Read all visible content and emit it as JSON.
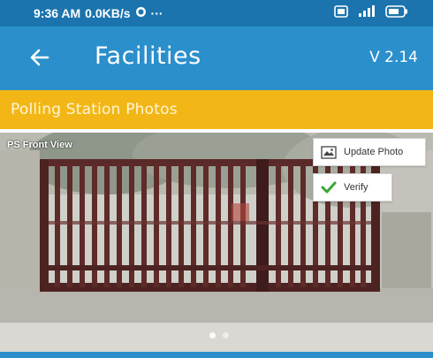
{
  "status_bar": {
    "time": "9:36 AM",
    "speed": "0.0KB/s",
    "more": "···",
    "icons": [
      "whatsapp-icon",
      "sim-icon",
      "signal-icon",
      "battery-icon"
    ]
  },
  "app_bar": {
    "back_icon": "arrow-left-icon",
    "title": "Facilities",
    "version": "V 2.14"
  },
  "section": {
    "title": "Polling Station Photos"
  },
  "photo": {
    "caption": "PS Front View",
    "update_label": "Update Photo",
    "update_icon": "image-icon",
    "verify_label": "Verify",
    "verify_icon": "check-icon",
    "pages": 2,
    "current_page": 1
  },
  "colors": {
    "status_bar": "#1b74ad",
    "app_bar": "#2b8fcc",
    "banner": "#f2b716",
    "verify_check": "#3aa635"
  }
}
